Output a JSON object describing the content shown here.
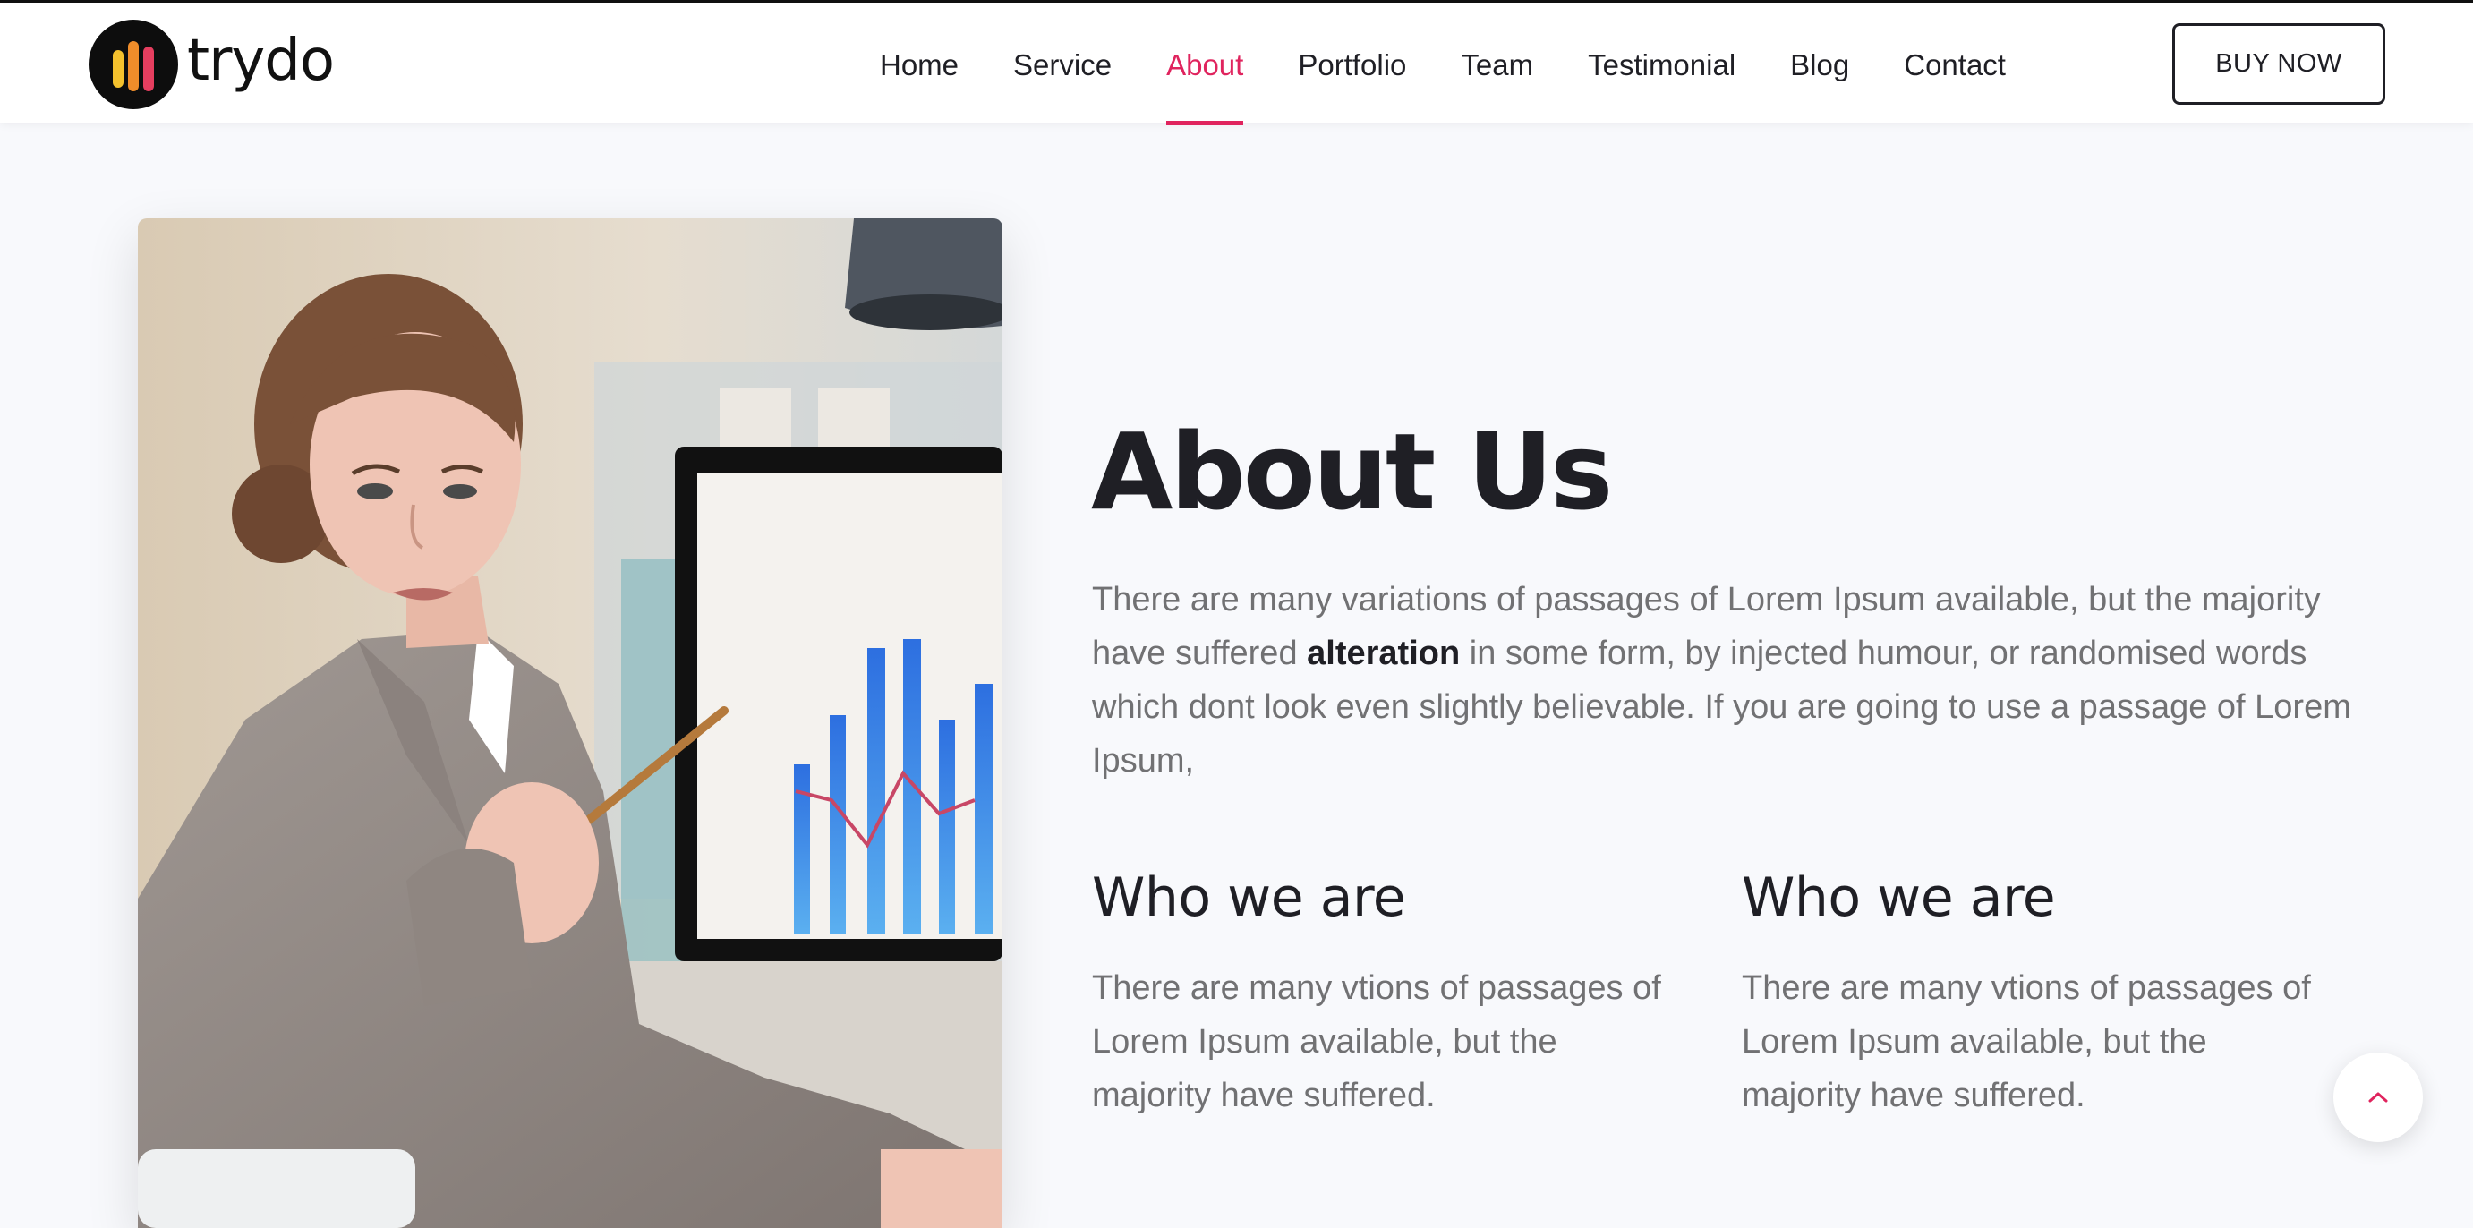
{
  "brand": {
    "name": "trydo",
    "logo_icon": "bars-logo-icon",
    "logo_colors": [
      "#f4c12d",
      "#ef8d2a",
      "#e53e5f"
    ]
  },
  "nav": {
    "items": [
      {
        "label": "Home",
        "active": false
      },
      {
        "label": "Service",
        "active": false
      },
      {
        "label": "About",
        "active": true
      },
      {
        "label": "Portfolio",
        "active": false
      },
      {
        "label": "Team",
        "active": false
      },
      {
        "label": "Testimonial",
        "active": false
      },
      {
        "label": "Blog",
        "active": false
      },
      {
        "label": "Contact",
        "active": false
      }
    ],
    "buy_label": "BUY NOW"
  },
  "about": {
    "title": "About Us",
    "desc_before": "There are many variations of passages of Lorem Ipsum available, but the majority have suffered ",
    "desc_bold": "alteration",
    "desc_after": " in some form, by injected humour, or randomised words which dont look even slightly believable. If you are going to use a passage of Lorem Ipsum,",
    "columns": [
      {
        "title": "Who we are",
        "text": "There are many vtions of passages of Lorem Ipsum available, but the majority have suffered."
      },
      {
        "title": "Who we are",
        "text": "There are many vtions of passages of Lorem Ipsum available, but the majority have suffered."
      }
    ]
  },
  "image": {
    "icon": "businesswoman-photo"
  },
  "scroll_top": {
    "icon": "chevron-up-icon"
  },
  "colors": {
    "accent": "#e0245e",
    "heading": "#1f1f25",
    "body_text": "#717173",
    "page_bg": "#f8f9fc"
  }
}
